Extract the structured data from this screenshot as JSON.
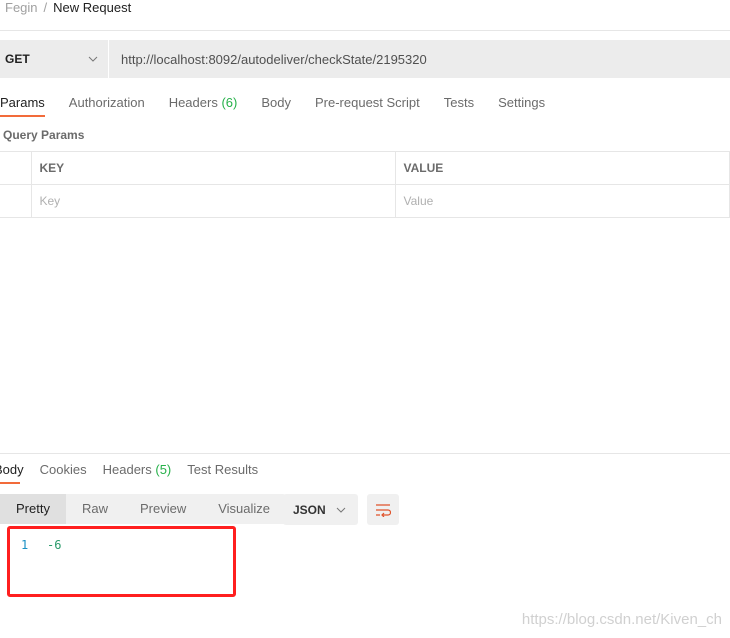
{
  "breadcrumb": {
    "collection": "Fegin",
    "separator": "/",
    "request": "New Request"
  },
  "request": {
    "method": "GET",
    "url": "http://localhost:8092/autodeliver/checkState/2195320"
  },
  "request_tabs": [
    {
      "label": "Params"
    },
    {
      "label": "Authorization"
    },
    {
      "label": "Headers",
      "count": "(6)"
    },
    {
      "label": "Body"
    },
    {
      "label": "Pre-request Script"
    },
    {
      "label": "Tests"
    },
    {
      "label": "Settings"
    }
  ],
  "query_params": {
    "title": "Query Params",
    "headers": [
      "KEY",
      "VALUE"
    ],
    "placeholders": [
      "Key",
      "Value"
    ]
  },
  "response_tabs": [
    {
      "label": "Body"
    },
    {
      "label": "Cookies"
    },
    {
      "label": "Headers",
      "count": "(5)"
    },
    {
      "label": "Test Results"
    }
  ],
  "view_modes": [
    "Pretty",
    "Raw",
    "Preview",
    "Visualize"
  ],
  "format": "JSON",
  "response_body": {
    "line": "1",
    "value": "-6"
  },
  "watermark": "https://blog.csdn.net/Kiven_ch",
  "colors": {
    "accent": "#f26b3a",
    "count": "#26b14a",
    "highlight_box": "#ff1f1f"
  }
}
